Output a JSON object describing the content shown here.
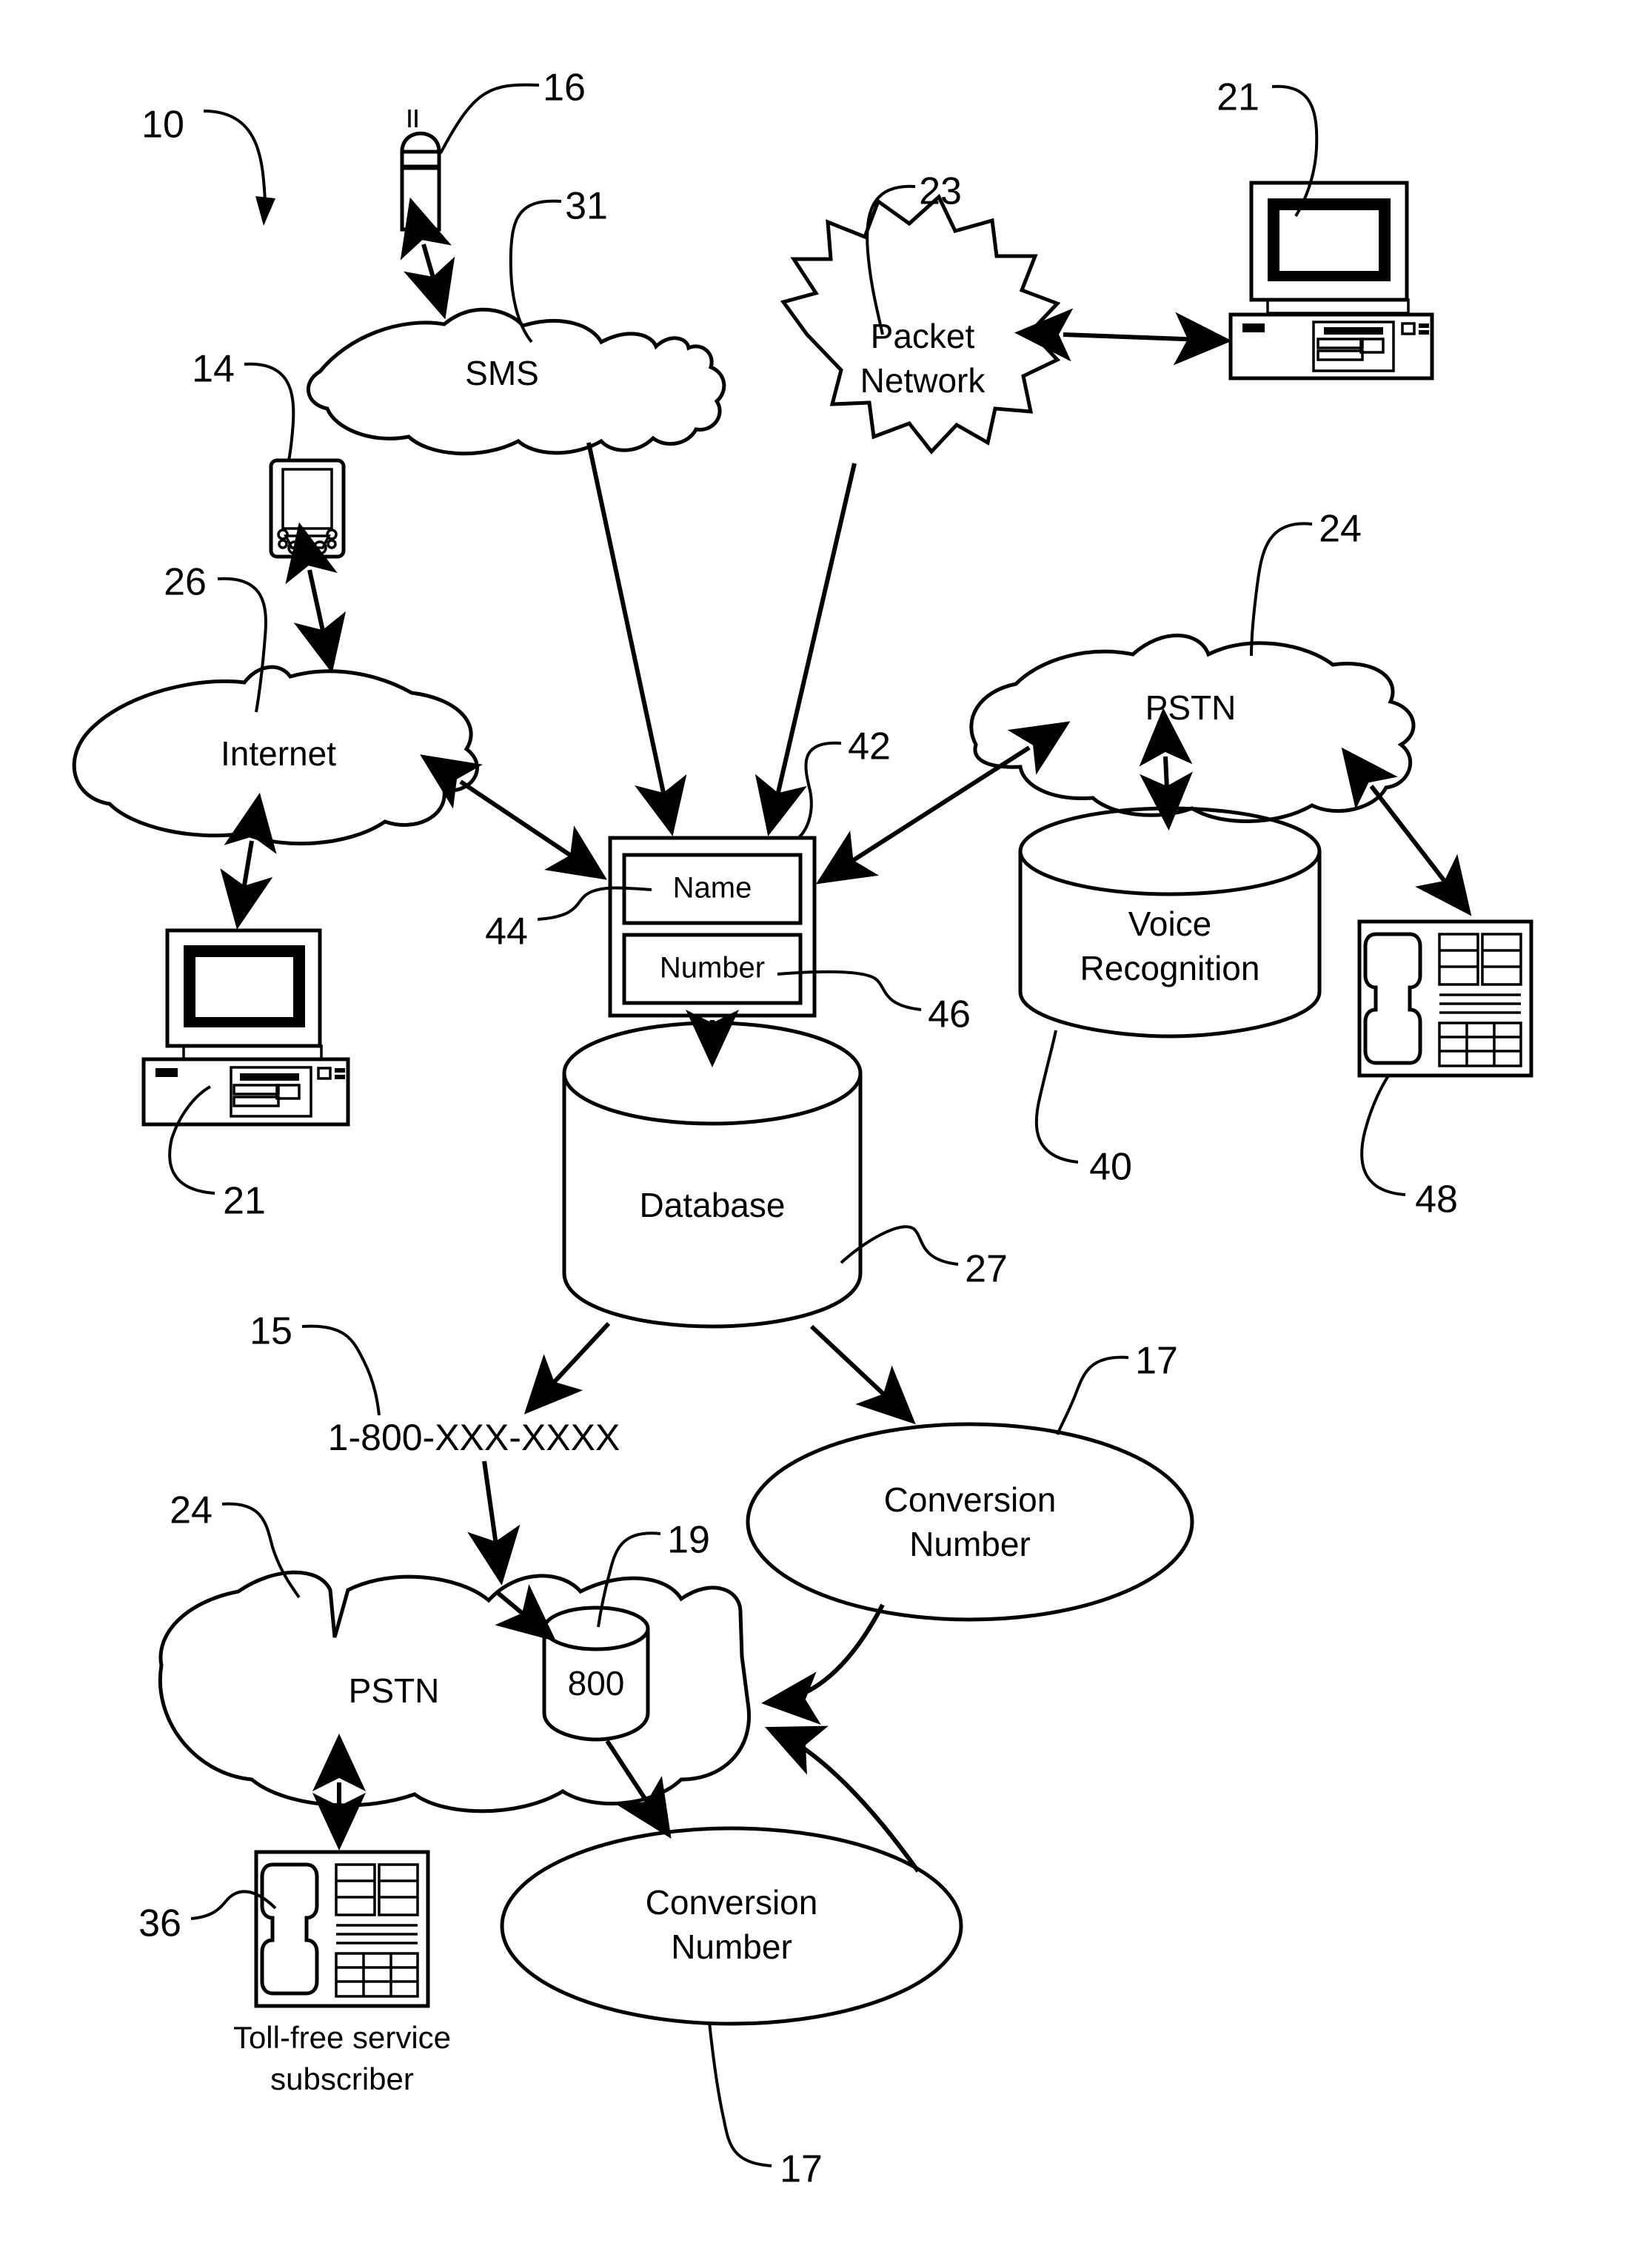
{
  "figure": {
    "title": "Telecommunication name/number conversion system schematic",
    "system_ref": "10"
  },
  "nodes": {
    "sms_cloud": "SMS",
    "packet_network_cloud": "Packet Network",
    "internet_cloud": "Internet",
    "pstn_cloud_top": "PSTN",
    "pstn_cloud_bottom": "PSTN",
    "voice_recognition_cylinder": "Voice Recognition",
    "database_cylinder": "Database",
    "record_name_field": "Name",
    "record_number_field": "Number",
    "toll_free_number": "1-800-XXX-XXXX",
    "eight_hundred_cylinder": "800",
    "conversion_number_right": "Conversion Number",
    "conversion_number_bottom": "Conversion Number",
    "toll_free_subscriber_caption_line1": "Toll-free service",
    "toll_free_subscriber_caption_line2": "subscriber"
  },
  "reference_numerals": {
    "system": "10",
    "pda_device": "14",
    "toll_free_number_label": "15",
    "mobile_phone": "16",
    "conversion_number_right_label": "17",
    "conversion_number_bottom_label": "17",
    "eight_hundred_db_label": "19",
    "computer_top_right": "21",
    "computer_left": "21",
    "packet_network": "23",
    "pstn_top": "24",
    "pstn_bottom": "24",
    "internet": "26",
    "database": "27",
    "sms": "31",
    "subscriber_phone": "36",
    "voice_recognition": "40",
    "record_container": "42",
    "name_field_label": "44",
    "number_field_label": "46",
    "telephone_right": "48"
  },
  "colors": {
    "ink": "#000000",
    "paper": "#ffffff"
  }
}
